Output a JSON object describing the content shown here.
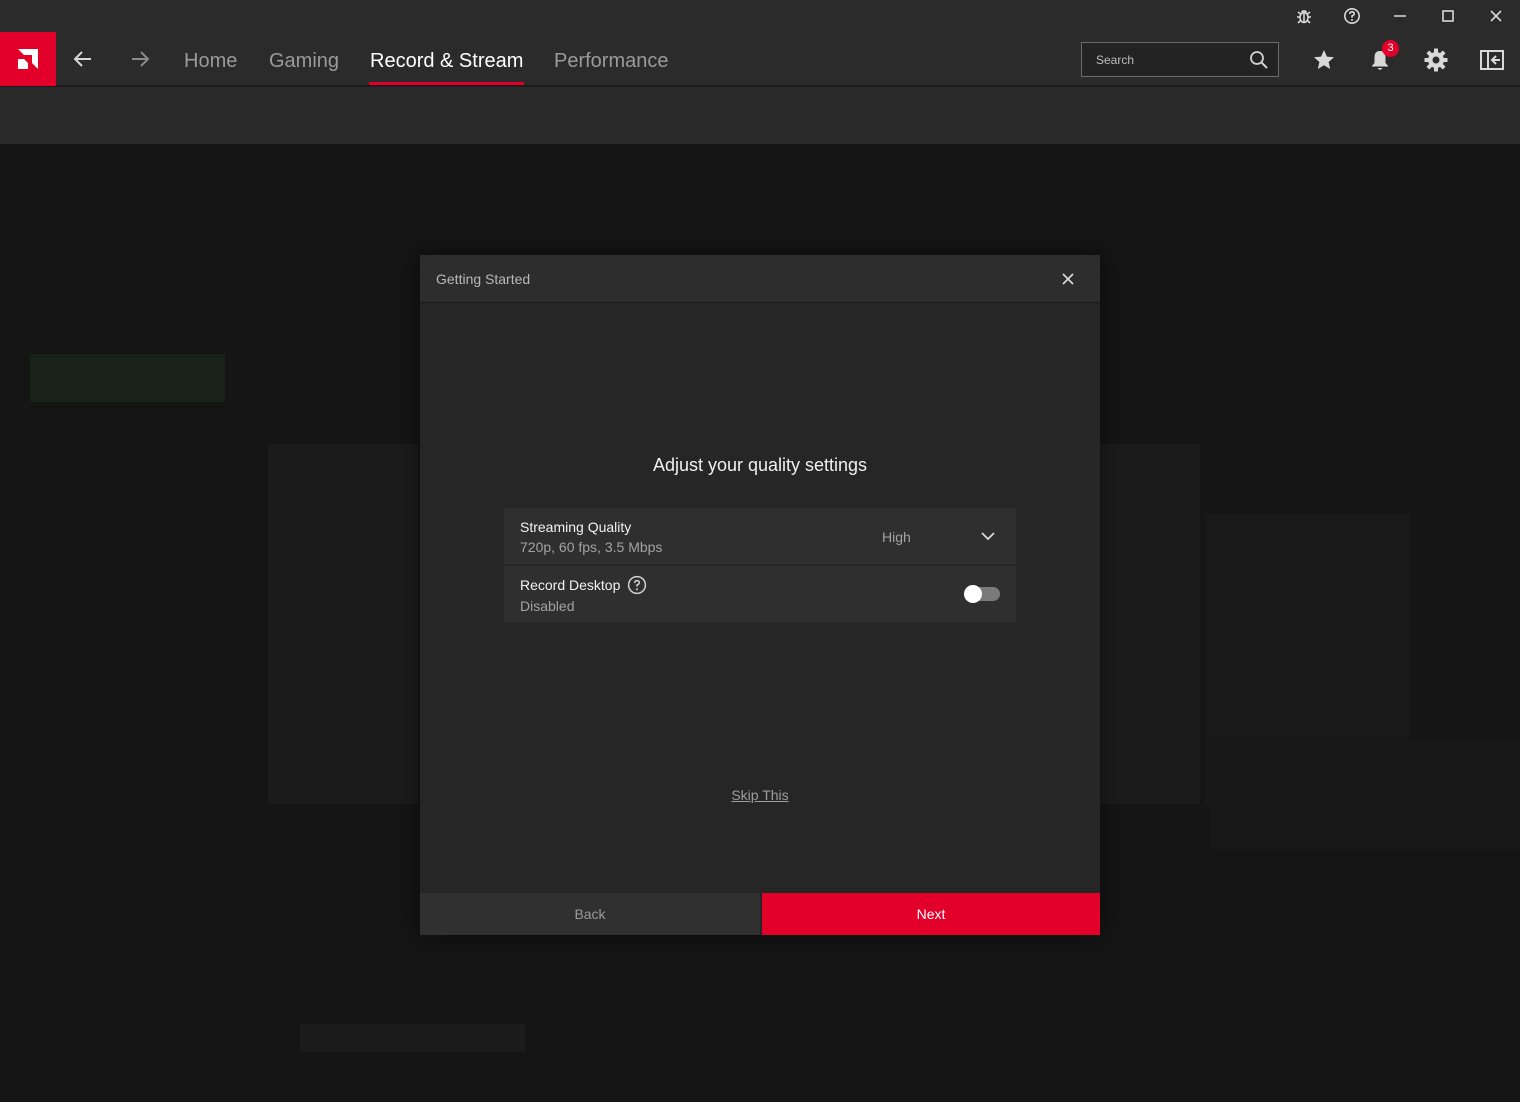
{
  "nav": {
    "tabs": [
      {
        "label": "Home"
      },
      {
        "label": "Gaming"
      },
      {
        "label": "Record & Stream"
      },
      {
        "label": "Performance"
      }
    ],
    "active_tab": "Record & Stream"
  },
  "search": {
    "placeholder": "Search"
  },
  "notifications": {
    "count": "3"
  },
  "toolbar_icons": [
    "star-icon",
    "bell-icon",
    "gear-icon",
    "sidebar-toggle-icon"
  ],
  "window_controls": [
    "bug-icon",
    "help-icon",
    "minimize-icon",
    "maximize-icon",
    "close-icon"
  ],
  "colors": {
    "accent": "#e2002b",
    "background": "#1b1b1b",
    "dialog": "#262626"
  },
  "dialog": {
    "title": "Getting Started",
    "heading": "Adjust your quality settings",
    "settings": [
      {
        "title": "Streaming Quality",
        "subtitle": "720p, 60 fps, 3.5 Mbps",
        "value": "High"
      },
      {
        "title": "Record Desktop",
        "subtitle": "Disabled",
        "toggle_on": false
      }
    ],
    "skip_label": "Skip This",
    "back_label": "Back",
    "next_label": "Next"
  }
}
